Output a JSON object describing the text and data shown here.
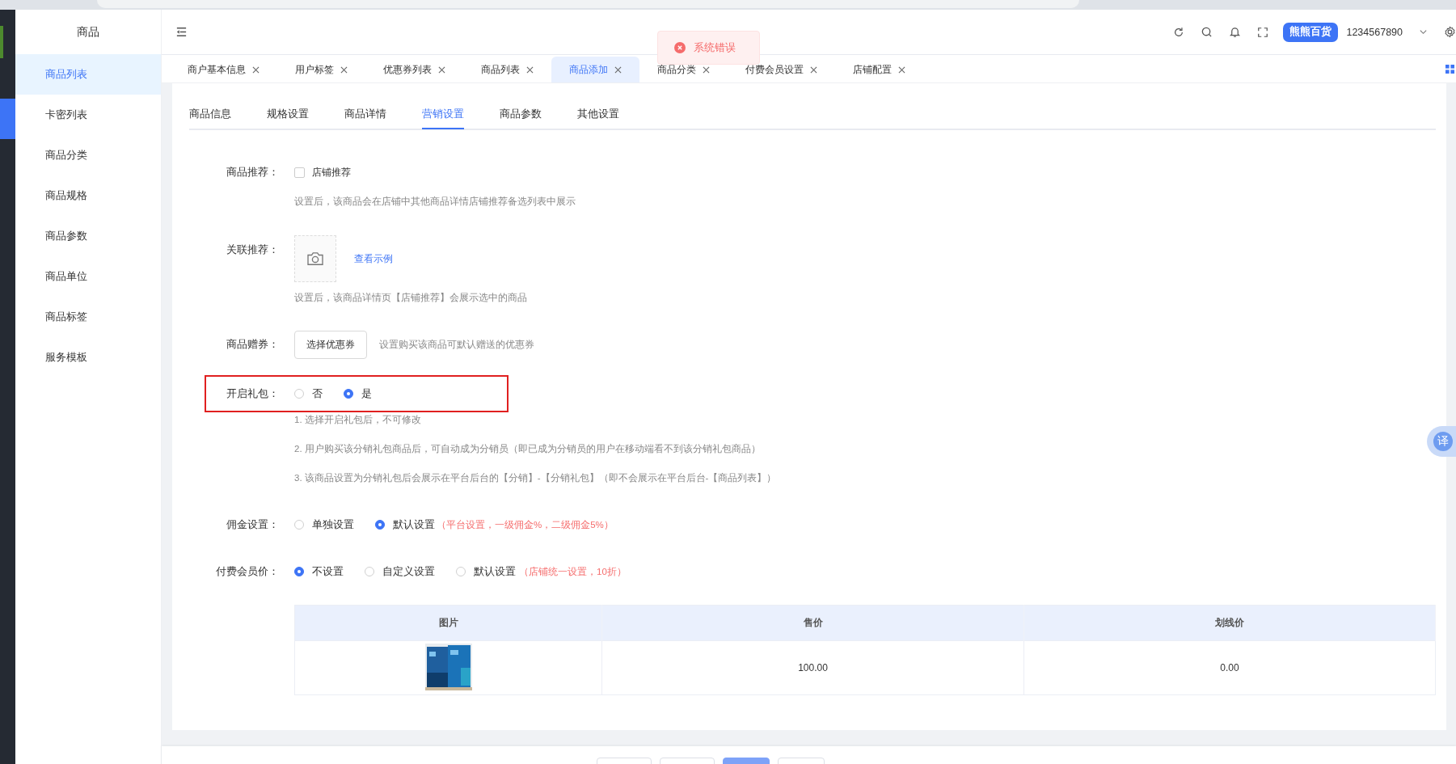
{
  "sidebar": {
    "title": "商品",
    "items": [
      {
        "label": "商品列表",
        "selected": true
      },
      {
        "label": "卡密列表",
        "selected": false
      },
      {
        "label": "商品分类",
        "selected": false
      },
      {
        "label": "商品规格",
        "selected": false
      },
      {
        "label": "商品参数",
        "selected": false
      },
      {
        "label": "商品单位",
        "selected": false
      },
      {
        "label": "商品标签",
        "selected": false
      },
      {
        "label": "服务模板",
        "selected": false
      }
    ]
  },
  "header": {
    "store_button": "熊熊百货",
    "account": "1234567890"
  },
  "toast": {
    "kind": "error",
    "message": "系统错误"
  },
  "tags": [
    {
      "label": "商户基本信息",
      "selected": false
    },
    {
      "label": "用户标签",
      "selected": false
    },
    {
      "label": "优惠券列表",
      "selected": false
    },
    {
      "label": "商品列表",
      "selected": false
    },
    {
      "label": "商品添加",
      "selected": true
    },
    {
      "label": "商品分类",
      "selected": false
    },
    {
      "label": "付费会员设置",
      "selected": false
    },
    {
      "label": "店铺配置",
      "selected": false
    }
  ],
  "subtabs": [
    {
      "label": "商品信息",
      "selected": false
    },
    {
      "label": "规格设置",
      "selected": false
    },
    {
      "label": "商品详情",
      "selected": false
    },
    {
      "label": "营销设置",
      "selected": true
    },
    {
      "label": "商品参数",
      "selected": false
    },
    {
      "label": "其他设置",
      "selected": false
    }
  ],
  "form": {
    "recommend": {
      "label": "商品推荐：",
      "option": "店铺推荐",
      "checked": false,
      "hint": "设置后，该商品会在店铺中其他商品详情店铺推荐备选列表中展示"
    },
    "related": {
      "label": "关联推荐：",
      "link": "查看示例",
      "hint": "设置后，该商品详情页【店铺推荐】会展示选中的商品"
    },
    "coupon": {
      "label": "商品赠券：",
      "button": "选择优惠券",
      "hint": "设置购买该商品可默认赠送的优惠券"
    },
    "gift_pack": {
      "label": "开启礼包：",
      "highlighted": true,
      "options": [
        {
          "label": "否",
          "selected": false
        },
        {
          "label": "是",
          "selected": true
        }
      ],
      "notes": [
        "1. 选择开启礼包后，不可修改",
        "2. 用户购买该分销礼包商品后，可自动成为分销员（即已成为分销员的用户在移动端看不到该分销礼包商品）",
        "3. 该商品设置为分销礼包后会展示在平台后台的【分销】-【分销礼包】（即不会展示在平台后台-【商品列表】）"
      ]
    },
    "commission": {
      "label": "佣金设置：",
      "options": [
        {
          "label": "单独设置",
          "selected": false
        },
        {
          "label": "默认设置",
          "selected": true
        }
      ],
      "note": "（平台设置，一级佣金%，二级佣金5%）"
    },
    "member_price": {
      "label": "付费会员价：",
      "options": [
        {
          "label": "不设置",
          "selected": true
        },
        {
          "label": "自定义设置",
          "selected": false
        },
        {
          "label": "默认设置",
          "selected": false
        }
      ],
      "note": "（店铺统一设置，10折）"
    }
  },
  "table": {
    "columns": [
      "图片",
      "售价",
      "划线价"
    ],
    "rows": [
      {
        "price": "100.00",
        "strike_price": "0.00"
      }
    ]
  },
  "translate_button": "译"
}
